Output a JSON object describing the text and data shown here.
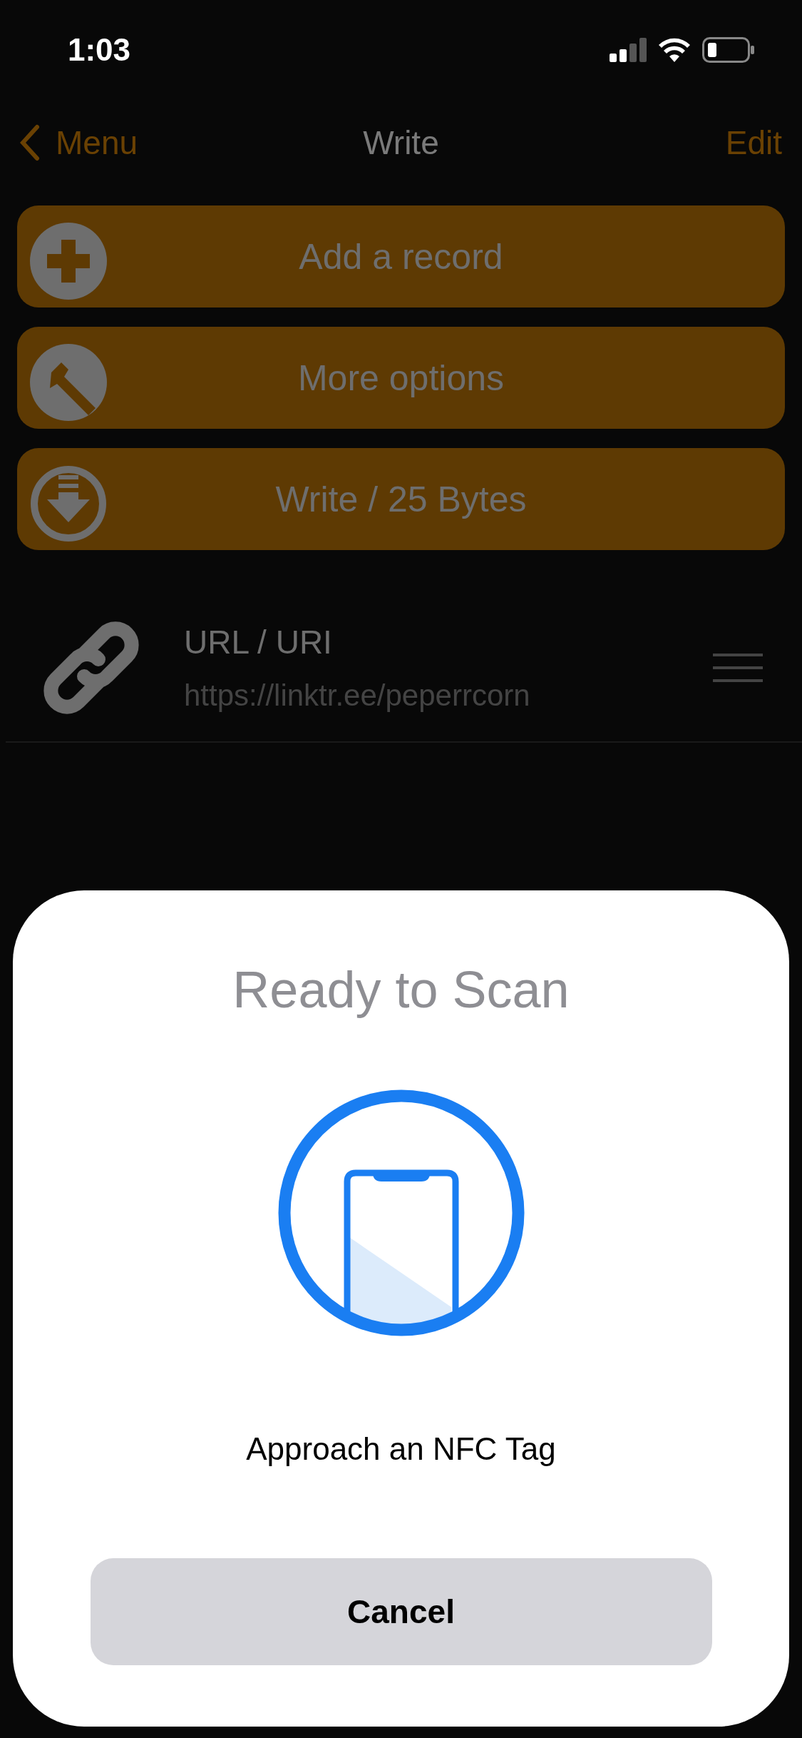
{
  "status_bar": {
    "time": "1:03"
  },
  "nav": {
    "back": "Menu",
    "title": "Write",
    "action": "Edit"
  },
  "actions": [
    {
      "label": "Add a record",
      "kind": "add"
    },
    {
      "label": "More options",
      "kind": "options"
    },
    {
      "label": "Write / 25 Bytes",
      "kind": "write"
    }
  ],
  "records": [
    {
      "type": "URL / URI",
      "value": "https://linktr.ee/peperrcorn"
    }
  ],
  "sheet": {
    "title": "Ready to Scan",
    "message": "Approach an NFC Tag",
    "cancel": "Cancel"
  }
}
